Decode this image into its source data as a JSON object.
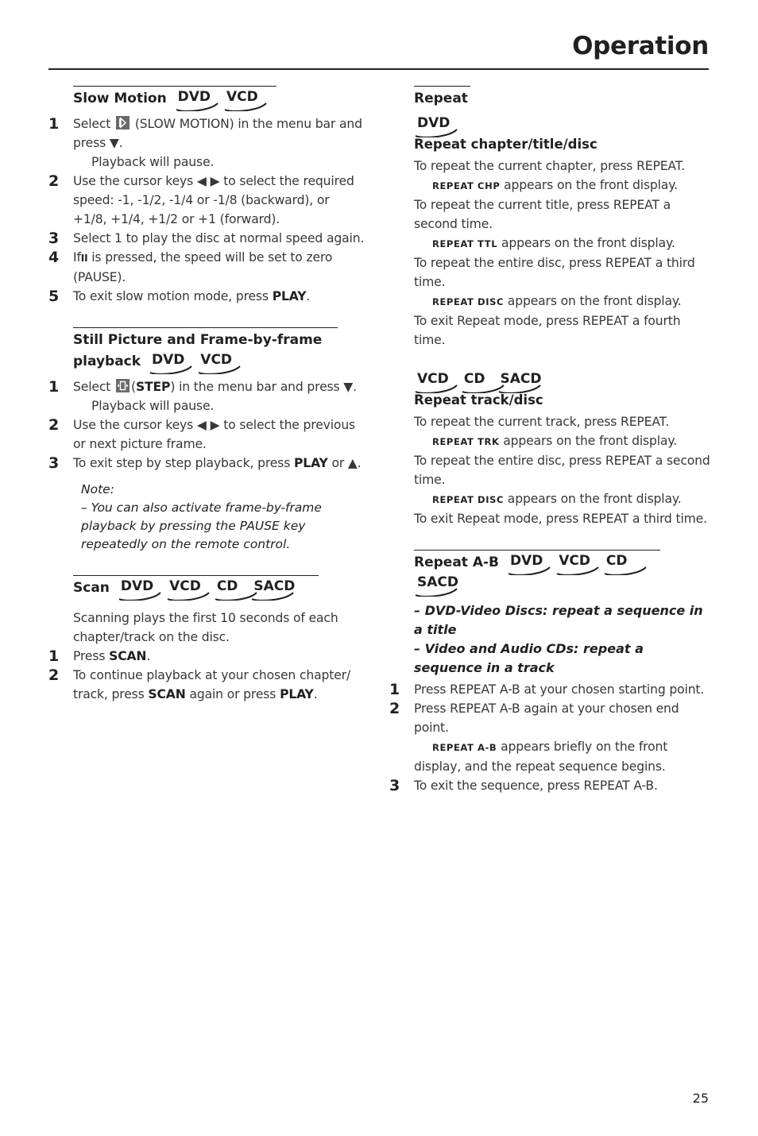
{
  "header": {
    "title": "Operation"
  },
  "page_number": "25",
  "left": {
    "slow_motion": {
      "title": "Slow Motion",
      "discs": [
        "DVD",
        "VCD"
      ],
      "steps": [
        {
          "num": "1",
          "pre": "Select",
          "icon": "slow-motion-icon",
          "post": "(SLOW MOTION) in the menu bar and press ▼.",
          "result": "Playback will pause."
        },
        {
          "num": "2",
          "text": "Use the cursor keys ◀ ▶ to select the required speed: -1, -1/2, -1/4 or -1/8 (backward), or +1/8, +1/4, +1/2 or +1 (forward)."
        },
        {
          "num": "3",
          "text": "Select 1 to play the disc at normal speed again."
        },
        {
          "num": "4",
          "pre": "If",
          "glyph": "II",
          "post": "is pressed, the speed will be set to zero (PAUSE)."
        },
        {
          "num": "5",
          "pre": "To exit slow motion mode, press",
          "key": "PLAY",
          "post": "."
        }
      ]
    },
    "still_picture": {
      "title_line1": "Still Picture and Frame-by-frame",
      "title_line2": "playback",
      "discs": [
        "DVD",
        "VCD"
      ],
      "steps": [
        {
          "num": "1",
          "pre": "Select",
          "icon": "step-icon",
          "paren_open": "(",
          "key": "STEP",
          "post": ") in the menu bar and press ▼.",
          "result": "Playback will pause."
        },
        {
          "num": "2",
          "text": "Use the cursor keys ◀ ▶ to select the previous or next picture frame."
        },
        {
          "num": "3",
          "pre": "To exit step by step playback, press",
          "key": "PLAY",
          "post": "or ▲."
        }
      ],
      "note_label": "Note:",
      "note_text": "–    You can also activate frame-by-frame playback by pressing the PAUSE key repeatedly on the remote control."
    },
    "scan": {
      "title": "Scan",
      "discs": [
        "DVD",
        "VCD",
        "CD",
        "SACD"
      ],
      "intro": "Scanning plays the first 10 seconds of each chapter/track on the disc.",
      "steps": [
        {
          "num": "1",
          "pre": "Press",
          "key": "SCAN",
          "post": "."
        },
        {
          "num": "2",
          "pre": "To continue playback at your chosen chapter/ track, press",
          "key": "SCAN",
          "mid": "again or press",
          "key2": "PLAY",
          "post": "."
        }
      ]
    }
  },
  "right": {
    "repeat": {
      "title": "Repeat",
      "dvd_block": {
        "discs": [
          "DVD"
        ],
        "subtitle": "Repeat chapter/title/disc",
        "lines": [
          {
            "type": "text",
            "text": "To repeat the current chapter, press REPEAT."
          },
          {
            "type": "display",
            "code": "REPEAT CHP",
            "text": "appears on the front display."
          },
          {
            "type": "text",
            "text": "To repeat the current title, press REPEAT a second time."
          },
          {
            "type": "display",
            "code": "REPEAT TTL",
            "text": "appears on the front display."
          },
          {
            "type": "text",
            "text": "To repeat the entire disc, press REPEAT a third time."
          },
          {
            "type": "display",
            "code": "REPEAT DISC",
            "text": "appears on the front display."
          },
          {
            "type": "text",
            "text": "To exit Repeat mode, press REPEAT a fourth time."
          }
        ]
      },
      "cd_block": {
        "discs": [
          "VCD",
          "CD",
          "SACD"
        ],
        "subtitle": "Repeat track/disc",
        "lines": [
          {
            "type": "text",
            "text": "To repeat the current track, press REPEAT."
          },
          {
            "type": "display",
            "code": "REPEAT TRK",
            "text": "appears on the front display."
          },
          {
            "type": "text",
            "text": "To repeat the entire disc, press REPEAT a second time."
          },
          {
            "type": "display",
            "code": "REPEAT DISC",
            "text": "appears on the front display."
          },
          {
            "type": "text",
            "text": "To exit Repeat mode, press REPEAT a third time."
          }
        ]
      }
    },
    "repeat_ab": {
      "title": "Repeat A-B",
      "discs": [
        "DVD",
        "VCD",
        "CD",
        "SACD"
      ],
      "bullets": [
        "–   DVD-Video Discs: repeat a sequence in a title",
        "–   Video and Audio CDs: repeat a sequence in a track"
      ],
      "steps": [
        {
          "num": "1",
          "text": "Press REPEAT A-B at your chosen starting point."
        },
        {
          "num": "2",
          "text": "Press REPEAT A-B again at your chosen end point.",
          "display_code": "REPEAT A-B",
          "display_text": "appears briefly on the front display, and the repeat sequence begins."
        },
        {
          "num": "3",
          "text": "To exit the sequence, press REPEAT A-B."
        }
      ]
    }
  }
}
